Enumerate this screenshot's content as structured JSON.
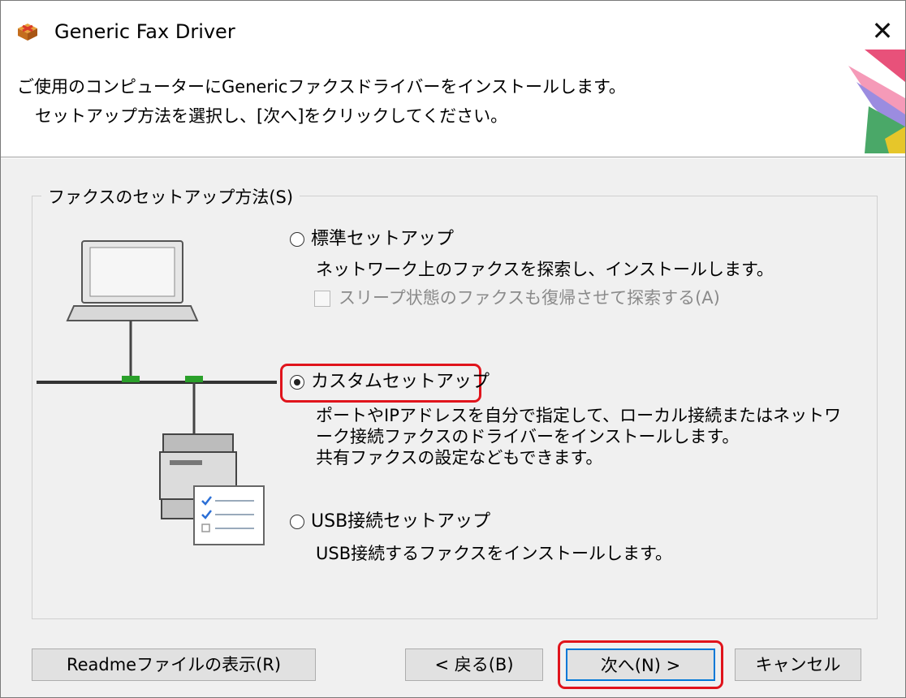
{
  "window": {
    "title": "Generic Fax Driver",
    "close_glyph": "✕"
  },
  "header": {
    "line1": "ご使用のコンピューターにGenericファクスドライバーをインストールします。",
    "line2": "セットアップ方法を選択し、[次へ]をクリックしてください。"
  },
  "group": {
    "legend": "ファクスのセットアップ方法(S)",
    "options": [
      {
        "label": "標準セットアップ",
        "selected": false,
        "description": [
          "ネットワーク上のファクスを探索し、インストールします。"
        ],
        "checkbox": {
          "label": "スリープ状態のファクスも復帰させて探索する(A)",
          "checked": false,
          "enabled": false
        }
      },
      {
        "label": "カスタムセットアップ",
        "selected": true,
        "description": [
          "ポートやIPアドレスを自分で指定して、ローカル接続またはネットワ",
          "ーク接続ファクスのドライバーをインストールします。",
          "共有ファクスの設定などもできます。"
        ]
      },
      {
        "label": "USB接続セットアップ",
        "selected": false,
        "description": [
          "USB接続するファクスをインストールします。"
        ]
      }
    ]
  },
  "buttons": {
    "readme": "Readmeファイルの表示(R)",
    "back": "< 戻る(B)",
    "next": "次へ(N) >",
    "cancel": "キャンセル"
  },
  "colors": {
    "highlight": "#e0141c",
    "network_green": "#2aa02a",
    "dialog_bg": "#f0f0f0"
  },
  "icons": [
    "app-icon",
    "close-icon",
    "laptop-icon",
    "fax-machine-icon",
    "checklist-icon",
    "header-graphic"
  ]
}
